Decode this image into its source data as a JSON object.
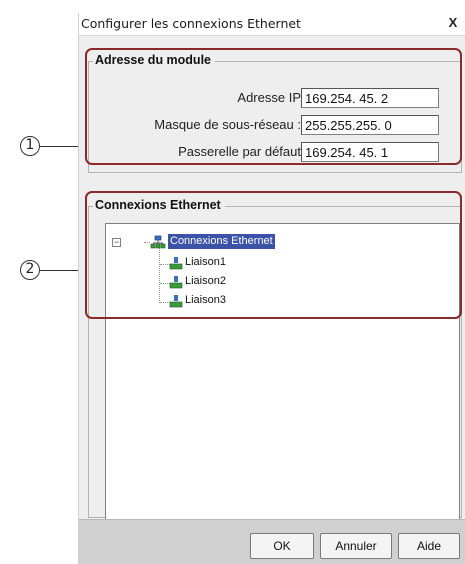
{
  "dialog": {
    "title": "Configurer les connexions Ethernet",
    "close_glyph": "X"
  },
  "module_group": {
    "legend": "Adresse du module",
    "fields": [
      {
        "label": "Adresse IP",
        "value": "169.254. 45. 2"
      },
      {
        "label": "Masque de sous-réseau :",
        "value": "255.255.255. 0"
      },
      {
        "label": "Passerelle par défaut",
        "value": "169.254. 45. 1"
      }
    ]
  },
  "connections_group": {
    "legend": "Connexions Ethernet",
    "tree": {
      "expander": "−",
      "root_label": "Connexions Ethernet",
      "root_icon": "network-icon",
      "children": [
        {
          "label": "Liaison1",
          "icon": "connection-icon"
        },
        {
          "label": "Liaison2",
          "icon": "connection-icon"
        },
        {
          "label": "Liaison3",
          "icon": "connection-icon"
        }
      ]
    }
  },
  "buttons": {
    "ok": "OK",
    "cancel": "Annuler",
    "help": "Aide"
  },
  "callouts": [
    "1",
    "2"
  ],
  "colors": {
    "highlight": "#8a2a2a",
    "selection": "#3a53a8",
    "icon_green": "#3c9a3c",
    "icon_blue": "#3a6fc0"
  }
}
